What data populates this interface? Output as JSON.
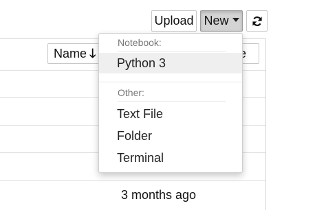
{
  "toolbar": {
    "upload_label": "Upload",
    "new_label": "New",
    "refresh_icon": "refresh-icon"
  },
  "file_list": {
    "sort_name_label": "Name",
    "sort_name_arrow": "🡓",
    "sort_size_label": "ze",
    "visible_modified": "3 months ago"
  },
  "new_menu": {
    "notebook_header": "Notebook:",
    "notebook_items": [
      "Python 3"
    ],
    "other_header": "Other:",
    "other_items": [
      "Text File",
      "Folder",
      "Terminal"
    ]
  },
  "colors": {
    "new_button_active_bg": "#d4d4d4",
    "menu_highlight_bg": "#efefef",
    "header_text": "#777777"
  }
}
